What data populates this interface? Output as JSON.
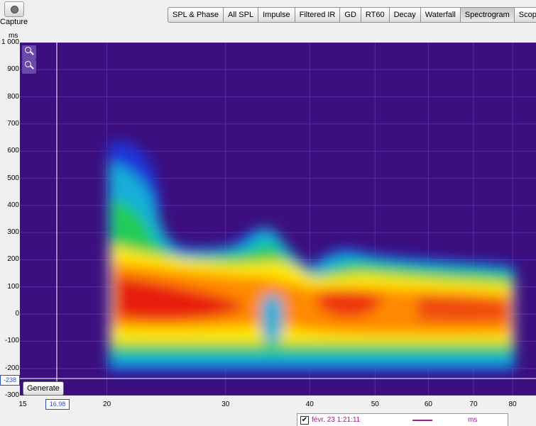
{
  "toolbar": {
    "capture_label": "Capture",
    "tabs": [
      "SPL & Phase",
      "All SPL",
      "Impulse",
      "Filtered IR",
      "GD",
      "RT60",
      "Decay",
      "Waterfall",
      "Spectrogram",
      "Scope"
    ],
    "active_tab": "Spectrogram"
  },
  "chart_data": {
    "type": "heatmap",
    "ylabel": "ms",
    "y_ticks": [
      "1 000",
      "900",
      "800",
      "700",
      "600",
      "500",
      "400",
      "300",
      "200",
      "100",
      "0",
      "-100",
      "-200",
      "-300"
    ],
    "x_ticks": [
      "15",
      "20",
      "30",
      "40",
      "50",
      "60",
      "70",
      "80"
    ],
    "ylim": [
      -300,
      1000
    ],
    "xlim": [
      15,
      80
    ],
    "x_scale": "log",
    "grid": true,
    "colors": {
      "background": "#3c0f7e",
      "grid": "#5a2aa8"
    },
    "y_cursor_value": "-238",
    "x_cursor_value": "16,98"
  },
  "generate_button": "Generate",
  "legend": {
    "checked": true,
    "name": "févr. 23 1:21:11",
    "unit": "ms",
    "color": "#a0208a"
  }
}
